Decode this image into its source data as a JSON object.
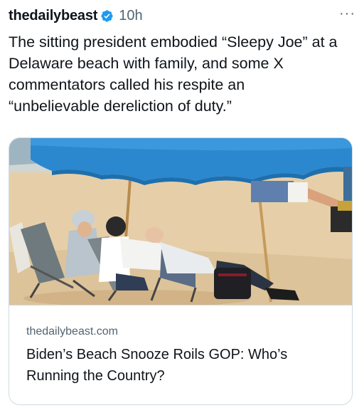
{
  "post": {
    "author": "thedailybeast",
    "verified_icon": "verified-badge-icon",
    "verified_color": "#1d9bf0",
    "timestamp": "10h",
    "more_label": "···",
    "text": "The sitting president embodied “Sleepy Joe” at a\nDelaware beach with family, and some X\ncommentators called his respite an\n“unbelievable dereliction of duty.”"
  },
  "card": {
    "domain": "thedailybeast.com",
    "title": "Biden’s Beach Snooze Roils GOP: Who’s\nRunning the Country?",
    "image_subject": "beach-photo",
    "umbrella_color": "#2b88cf",
    "sand_color": "#e6cfa8"
  }
}
